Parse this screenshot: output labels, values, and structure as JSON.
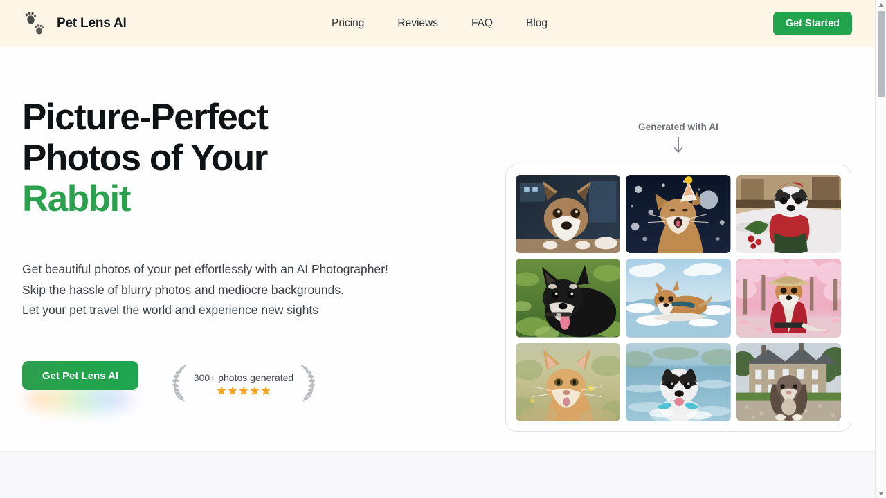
{
  "brand": {
    "name": "Pet Lens AI",
    "logo_icon": "paw-prints-icon",
    "green": "#22A34D",
    "header_bg": "#FDF6E7"
  },
  "header": {
    "nav": [
      {
        "label": "Pricing"
      },
      {
        "label": "Reviews"
      },
      {
        "label": "FAQ"
      },
      {
        "label": "Blog"
      }
    ],
    "cta_label": "Get Started"
  },
  "hero": {
    "headline_line1": "Picture-Perfect",
    "headline_line2": "Photos of Your",
    "headline_highlight": "Rabbit",
    "subcopy_line1": "Get beautiful photos of your pet effortlessly with an AI Photographer!",
    "subcopy_line2": "Skip the hassle of blurry photos and mediocre backgrounds.",
    "subcopy_line3": "Let your pet travel the world and experience new sights",
    "cta_label": "Get Pet Lens AI",
    "badge": {
      "text": "300+ photos generated",
      "stars": 5,
      "star_color": "#F5A623",
      "laurel_icon": "laurel-wreath-icon"
    }
  },
  "gallery": {
    "note": "Generated with AI",
    "arrow_icon": "arrow-down-icon",
    "images": [
      {
        "alt": "corgi-dog-indoors-dark-blue",
        "subject": "corgi"
      },
      {
        "alt": "cat-with-party-hat-night-sky-moon",
        "subject": "cat"
      },
      {
        "alt": "boston-terrier-in-red-sweater-on-bed",
        "subject": "dog"
      },
      {
        "alt": "black-shiba-dog-in-green-grass",
        "subject": "dog"
      },
      {
        "alt": "corgi-surfing-on-ocean-wave",
        "subject": "corgi"
      },
      {
        "alt": "corgi-in-kimono-and-straw-hat-cherry-blossoms",
        "subject": "corgi"
      },
      {
        "alt": "ginger-kitten-in-meadow",
        "subject": "cat"
      },
      {
        "alt": "boston-terrier-swimming-in-lake",
        "subject": "dog"
      },
      {
        "alt": "lop-rabbit-in-front-of-manor-house",
        "subject": "rabbit"
      }
    ]
  },
  "scrollbar": {
    "up_icon": "scroll-up-arrow-icon",
    "down_icon": "scroll-down-arrow-icon"
  }
}
